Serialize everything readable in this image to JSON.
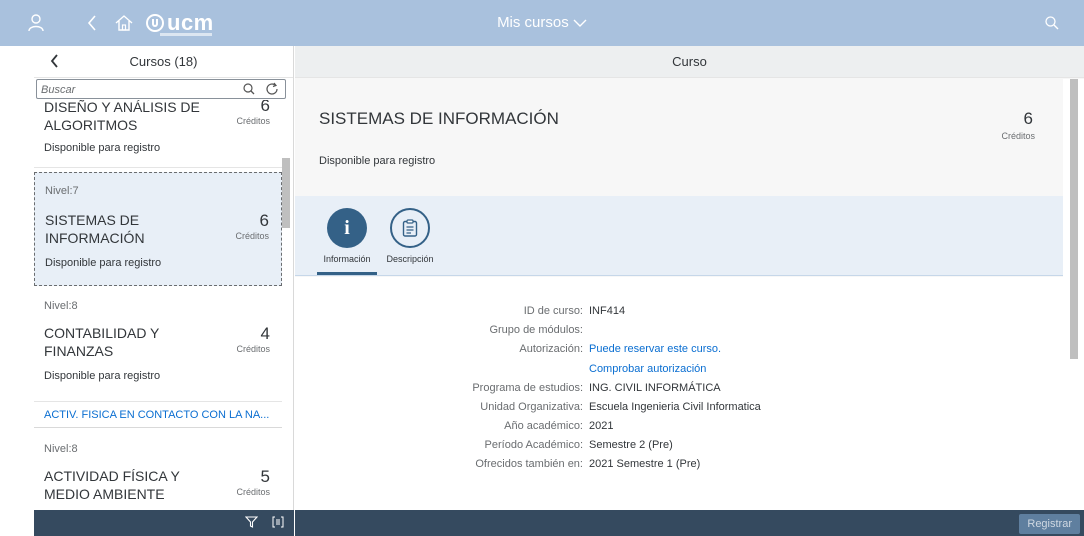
{
  "shell": {
    "title": "Mis cursos",
    "logo_text": "ucm"
  },
  "master": {
    "title": "Cursos (18)",
    "search_placeholder": "Buscar",
    "items": [
      {
        "level": "",
        "title": "DISEÑO Y ANÁLISIS DE ALGORITMOS",
        "credits": "6",
        "credits_label": "Créditos",
        "status": "Disponible para registro"
      },
      {
        "level": "Nivel:7",
        "title": "SISTEMAS DE INFORMACIÓN",
        "credits": "6",
        "credits_label": "Créditos",
        "status": "Disponible para registro"
      },
      {
        "level": "Nivel:8",
        "title": "CONTABILIDAD Y FINANZAS",
        "credits": "4",
        "credits_label": "Créditos",
        "status": "Disponible para registro"
      },
      {
        "level": "Nivel:8",
        "title": "ACTIVIDAD FÍSICA Y MEDIO AMBIENTE",
        "credits": "5",
        "credits_label": "Créditos",
        "status": ""
      }
    ],
    "group_header": "ACTIV. FISICA EN CONTACTO CON LA NA..."
  },
  "detail": {
    "header": "Curso",
    "title": "SISTEMAS DE INFORMACIÓN",
    "credits": "6",
    "credits_label": "Créditos",
    "status": "Disponible para registro",
    "tabs": [
      {
        "label": "Información",
        "icon": "info-icon",
        "glyph": "i"
      },
      {
        "label": "Descripción",
        "icon": "clipboard-icon"
      }
    ],
    "fields": [
      {
        "label": "ID de curso:",
        "value": "INF414",
        "link": false
      },
      {
        "label": "Grupo de módulos:",
        "value": "",
        "link": false
      },
      {
        "label": "Autorización:",
        "value": "Puede reservar este curso.",
        "link": true
      },
      {
        "label": "",
        "value": "Comprobar autorización",
        "link": true
      },
      {
        "label": "Programa de estudios:",
        "value": "ING. CIVIL INFORMÁTICA",
        "link": false
      },
      {
        "label": "Unidad Organizativa:",
        "value": "Escuela Ingenieria Civil Informatica",
        "link": false
      },
      {
        "label": "Año académico:",
        "value": "2021",
        "link": false
      },
      {
        "label": "Período Académico:",
        "value": "Semestre 2 (Pre)",
        "link": false
      },
      {
        "label": "Ofrecidos también en:",
        "value": "2021 Semestre 1 (Pre)",
        "link": false
      }
    ],
    "register_label": "Registrar"
  },
  "colors": {
    "shell": "#a9c1dd",
    "accent": "#346187",
    "footer": "#354a5f",
    "link": "#0a6ed1"
  }
}
